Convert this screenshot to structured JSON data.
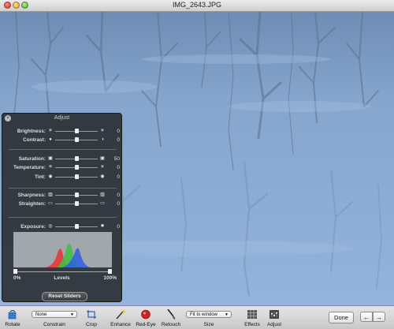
{
  "window": {
    "title": "IMG_2643.JPG"
  },
  "adjust": {
    "title": "Adjust",
    "rows": [
      {
        "label": "Brightness:",
        "left_icon": "☀",
        "right_icon": "☀",
        "value": "0",
        "level": 0.5
      },
      {
        "label": "Contrast:",
        "left_icon": "●",
        "right_icon": "◑",
        "value": "0",
        "level": 0.5
      },
      {
        "label": "Saturation:",
        "left_icon": "▣",
        "right_icon": "▣",
        "value": "50",
        "level": 0.5
      },
      {
        "label": "Temperature:",
        "left_icon": "✳",
        "right_icon": "☀",
        "value": "0",
        "level": 0.5
      },
      {
        "label": "Tint:",
        "left_icon": "◉",
        "right_icon": "◉",
        "value": "0",
        "level": 0.5
      },
      {
        "label": "Sharpness:",
        "left_icon": "▧",
        "right_icon": "▧",
        "value": "0",
        "level": 0.5
      },
      {
        "label": "Straighten:",
        "left_icon": "▭",
        "right_icon": "▭",
        "value": "0",
        "level": 0.5
      },
      {
        "label": "Exposure:",
        "left_icon": "◎",
        "right_icon": "✸",
        "value": "0",
        "level": 0.5
      }
    ],
    "levels": {
      "min_label": "0%",
      "label": "Levels",
      "max_label": "100%",
      "black_point": 0.0,
      "white_point": 1.0
    },
    "reset_label": "Reset Sliders"
  },
  "toolbar": {
    "rotate": "Rotate",
    "constrain_value": "None",
    "constrain": "Constrain",
    "crop": "Crop",
    "enhance": "Enhance",
    "redeye": "Red-Eye",
    "retouch": "Retouch",
    "size_value": "Fit to window",
    "size": "Size",
    "effects": "Effects",
    "adjust": "Adjust",
    "done": "Done",
    "prev": "←",
    "next": "→"
  },
  "colors": {
    "accent": "#4a7fd0",
    "panel_bg": "#2a2c30",
    "photo_blue": "#8eaed6"
  }
}
